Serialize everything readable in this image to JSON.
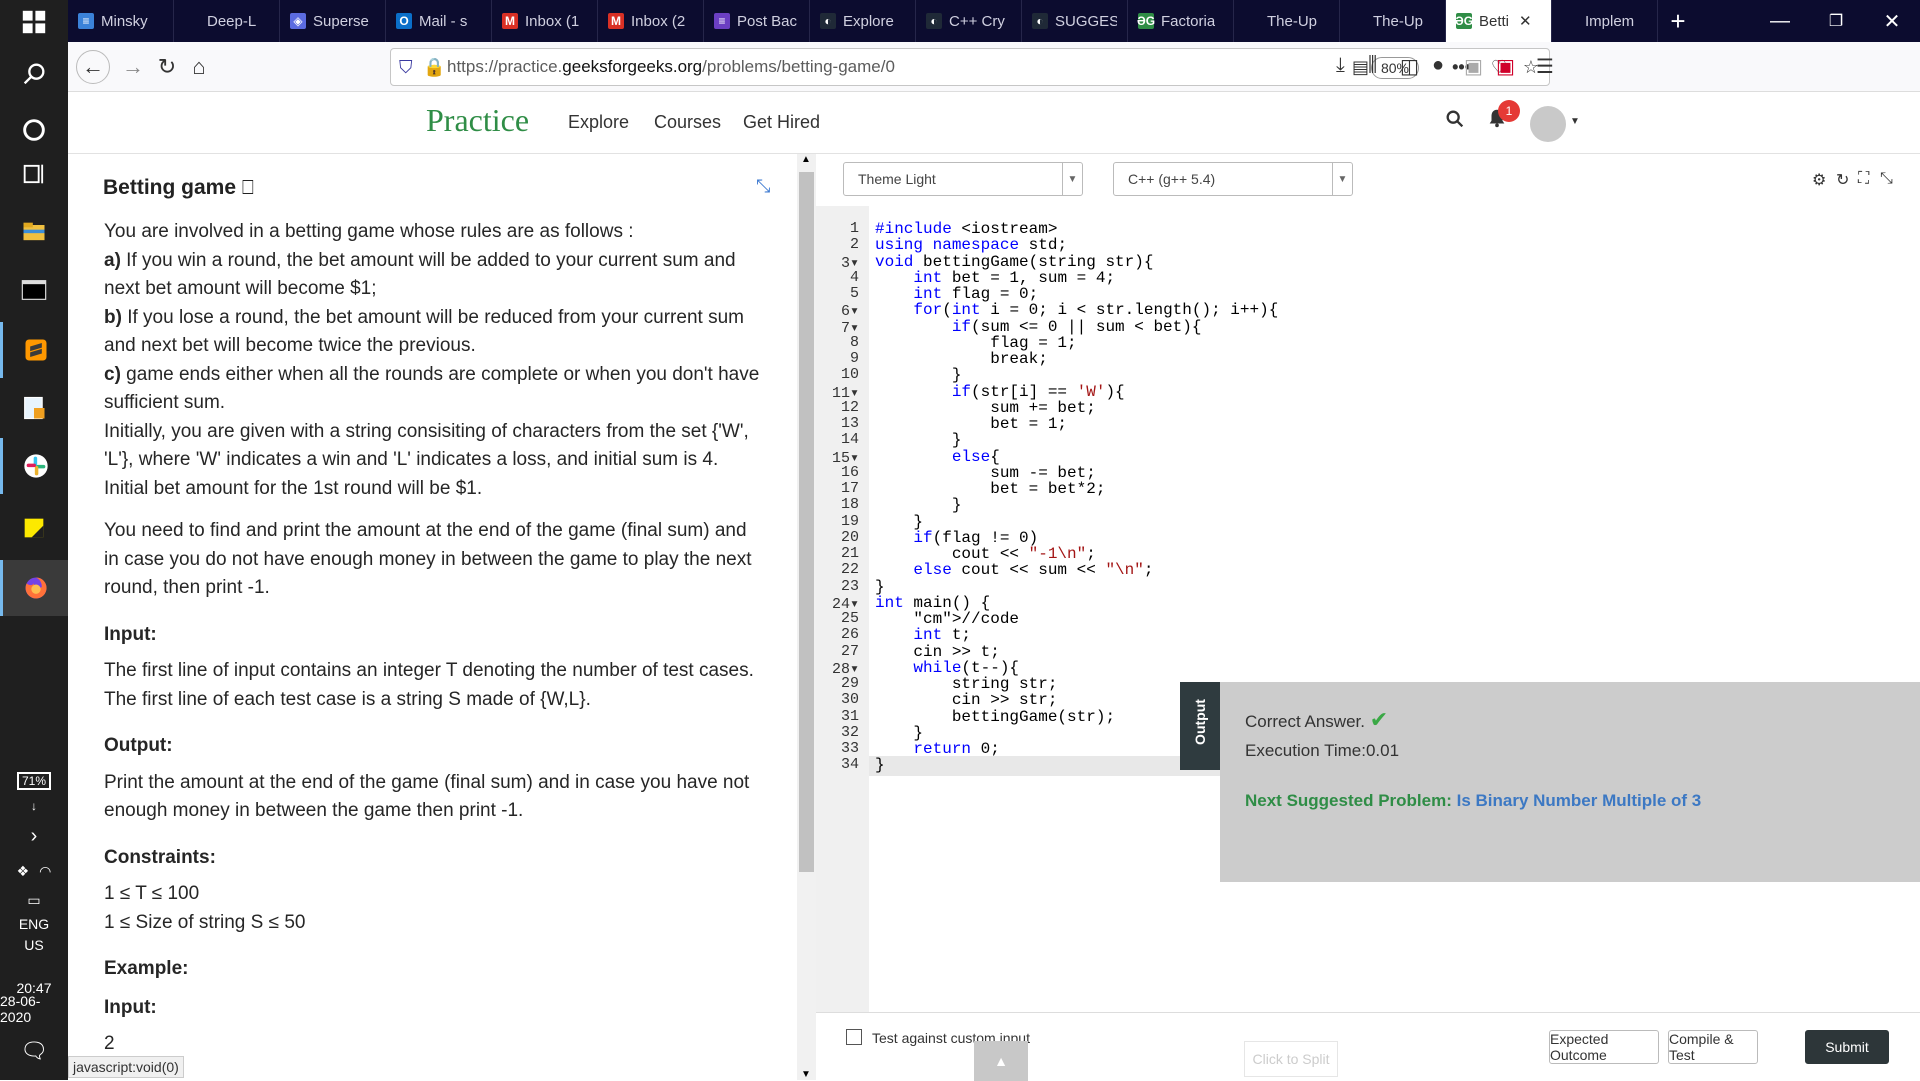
{
  "taskbar": {
    "icons": [
      "windows-start-icon",
      "search-icon",
      "cortana-icon",
      "task-view-icon",
      "file-explorer-icon",
      "terminal-icon",
      "sublime-icon",
      "notepad-icon",
      "slack-icon",
      "sticky-notes-icon",
      "firefox-icon"
    ],
    "battery": "71%",
    "language": "ENG",
    "region": "US",
    "time": "20:47",
    "date": "28-06-2020"
  },
  "tabs": [
    {
      "label": "Minsky",
      "fav": "≡",
      "fav_color": "#3b82d8"
    },
    {
      "label": "Deep-L",
      "fav": "",
      "fav_color": "#0c0c2f"
    },
    {
      "label": "Superse",
      "fav": "◈",
      "fav_color": "#5b6be0"
    },
    {
      "label": "Mail - s",
      "fav": "O",
      "fav_color": "#0b6fc9"
    },
    {
      "label": "Inbox (1",
      "fav": "M",
      "fav_color": "#d93025"
    },
    {
      "label": "Inbox (2",
      "fav": "M",
      "fav_color": "#d93025"
    },
    {
      "label": "Post Bac",
      "fav": "≡",
      "fav_color": "#6b3fc2"
    },
    {
      "label": "Explore",
      "fav": "◐",
      "fav_color": "#1f2937"
    },
    {
      "label": "C++ Cry",
      "fav": "◐",
      "fav_color": "#1f2937"
    },
    {
      "label": "SUGGES",
      "fav": "◐",
      "fav_color": "#1f2937"
    },
    {
      "label": "Factoria",
      "fav": "ƏG",
      "fav_color": "#2f8d46"
    },
    {
      "label": "The-Up",
      "fav": "",
      "fav_color": "#0c0c2f"
    },
    {
      "label": "The-Up",
      "fav": "",
      "fav_color": "#0c0c2f"
    },
    {
      "label": "Betti",
      "fav": "ƏG",
      "fav_color": "#2f8d46",
      "active": true
    },
    {
      "label": "Implem",
      "fav": "",
      "fav_color": "#0c0c2f"
    }
  ],
  "browser": {
    "url_prefix": "https://practice.",
    "url_domain": "geeksforgeeks.org",
    "url_path": "/problems/betting-game/0",
    "zoom": "80%",
    "status_text": "javascript:void(0)"
  },
  "site": {
    "logo": "Practice",
    "menu": [
      "Explore",
      "Courses",
      "Get Hired"
    ],
    "notification_count": "1"
  },
  "problem": {
    "title": "Betting game",
    "intro": "You are involved in a betting game whose rules are as follows :",
    "rule_a_label": "a)",
    "rule_a": " If you win a round, the bet amount will be added to your current sum and next bet amount will become $1;",
    "rule_b_label": "b)",
    "rule_b": " If you lose a round, the bet amount will be reduced from your current sum and next bet will become twice the previous.",
    "rule_c_label": "c)",
    "rule_c": " game ends either when all the rounds are complete or when you don't have sufficient sum.",
    "initial": "Initially, you are given with a string consisiting of characters from the set {'W', 'L'}, where 'W' indicates a win and 'L' indicates a loss, and initial sum is 4. Initial bet amount for the 1st round will be $1.",
    "task": "You need to find and print the amount at the end of the game (final sum) and in case you do not have enough money in between the game to play the next round, then print -1.",
    "input_heading": "Input:",
    "input_1": "The first line of input contains an integer T denoting the number of test cases.",
    "input_2": "The first line of each test case is a string S made of {W,L}.",
    "output_heading": "Output:",
    "output_text": "Print the amount at the end of the game (final sum) and in case you have not enough money in between the game then print -1.",
    "constraints_heading": "Constraints:",
    "constraint_1": "1 ≤ T ≤ 100",
    "constraint_2": "1 ≤ Size of string S ≤ 50",
    "example_heading": "Example:",
    "example_input_heading": "Input:",
    "example_input_first": "2"
  },
  "editor": {
    "theme": "Theme Light",
    "language": "C++ (g++ 5.4)",
    "lines": [
      "#include <iostream>",
      "using namespace std;",
      "void bettingGame(string str){",
      "    int bet = 1, sum = 4;",
      "    int flag = 0;",
      "    for(int i = 0; i < str.length(); i++){",
      "        if(sum <= 0 || sum < bet){",
      "            flag = 1;",
      "            break;",
      "        }",
      "        if(str[i] == 'W'){",
      "            sum += bet;",
      "            bet = 1;",
      "        }",
      "        else{",
      "            sum -= bet;",
      "            bet = bet*2;",
      "        }",
      "    }",
      "    if(flag != 0)",
      "        cout << \"-1\\n\";",
      "    else cout << sum << \"\\n\";",
      "}",
      "int main() {",
      "    //code",
      "    int t;",
      "    cin >> t;",
      "    while(t--){",
      "        string str;",
      "        cin >> str;",
      "        bettingGame(str);",
      "    }",
      "    return 0;",
      "}"
    ],
    "fold_lines": [
      3,
      6,
      7,
      11,
      15,
      24,
      28
    ]
  },
  "output": {
    "tab_label": "Output",
    "correct": "Correct Answer.",
    "time": "Execution Time:0.01",
    "next_label": "Next Suggested Problem: ",
    "next_link": "Is Binary Number Multiple of 3"
  },
  "bottom": {
    "custom_input_label": "Test against custom input",
    "click_to_split": "Click to Split",
    "expected_outcome": "Expected Outcome",
    "compile_test": "Compile & Test",
    "submit": "Submit"
  }
}
